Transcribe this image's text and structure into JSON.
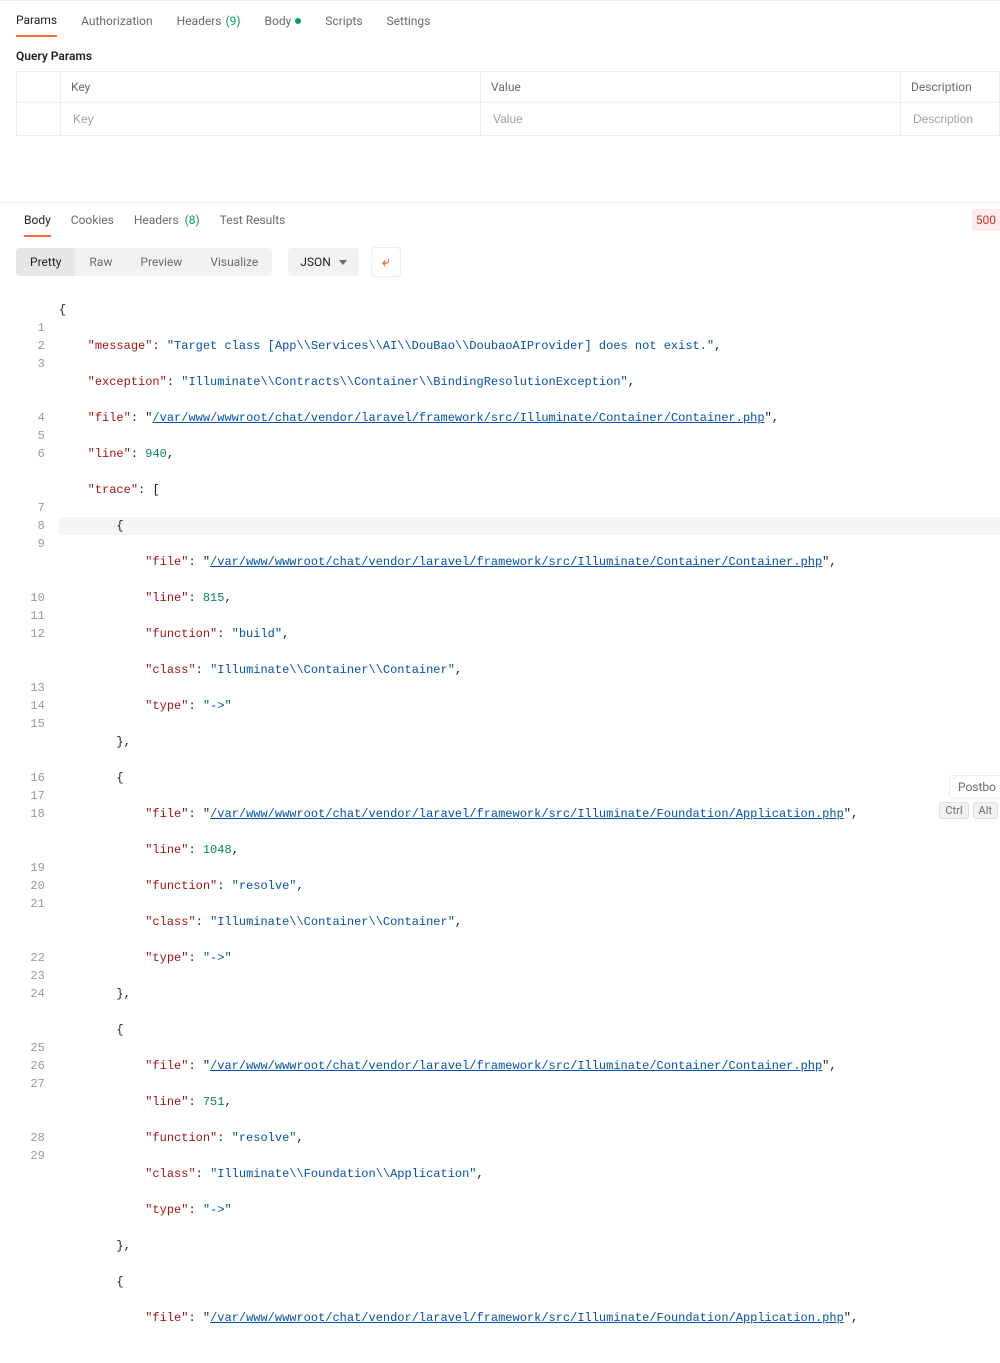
{
  "req_tabs": {
    "params": "Params",
    "authorization": "Authorization",
    "headers_label": "Headers",
    "headers_count": "(9)",
    "body": "Body",
    "scripts": "Scripts",
    "settings": "Settings"
  },
  "qp": {
    "title": "Query Params",
    "col_key": "Key",
    "col_value": "Value",
    "col_desc": "Description",
    "ph_key": "Key",
    "ph_value": "Value",
    "ph_desc": "Description"
  },
  "resp_tabs": {
    "body": "Body",
    "cookies": "Cookies",
    "headers_label": "Headers",
    "headers_count": "(8)",
    "test_results": "Test Results"
  },
  "status_code": "500",
  "toolbar": {
    "pretty": "Pretty",
    "raw": "Raw",
    "preview": "Preview",
    "visualize": "Visualize",
    "json": "JSON"
  },
  "code": {
    "l1": "{",
    "l2_k": "\"message\"",
    "l2_v": "\"Target class [App\\\\Services\\\\AI\\\\DouBao\\\\DoubaoAIProvider] does not exist.\"",
    "l3_k": "\"exception\"",
    "l3_v": "\"Illuminate\\\\Contracts\\\\Container\\\\BindingResolutionException\"",
    "l4_k": "\"file\"",
    "l4_v": "/var/www/wwwroot/chat/vendor/laravel/framework/src/Illuminate/Container/Container.php",
    "l5_k": "\"line\"",
    "l5_v": "940",
    "l6_k": "\"trace\"",
    "l7": "{",
    "l8_k": "\"file\"",
    "l8_v": "/var/www/wwwroot/chat/vendor/laravel/framework/src/Illuminate/Container/Container.php",
    "l9_k": "\"line\"",
    "l9_v": "815",
    "l10_k": "\"function\"",
    "l10_v": "\"build\"",
    "l11_k": "\"class\"",
    "l11_v": "\"Illuminate\\\\Container\\\\Container\"",
    "l12_k": "\"type\"",
    "l12_v": "\"->\"",
    "l13": "},",
    "l14": "{",
    "l15_k": "\"file\"",
    "l15_v": "/var/www/wwwroot/chat/vendor/laravel/framework/src/Illuminate/Foundation/Application.php",
    "l16_k": "\"line\"",
    "l16_v": "1048",
    "l17_k": "\"function\"",
    "l17_v": "\"resolve\"",
    "l18_k": "\"class\"",
    "l18_v": "\"Illuminate\\\\Container\\\\Container\"",
    "l19_k": "\"type\"",
    "l19_v": "\"->\"",
    "l20": "},",
    "l21": "{",
    "l22_k": "\"file\"",
    "l22_v": "/var/www/wwwroot/chat/vendor/laravel/framework/src/Illuminate/Container/Container.php",
    "l23_k": "\"line\"",
    "l23_v": "751",
    "l24_k": "\"function\"",
    "l24_v": "\"resolve\"",
    "l25_k": "\"class\"",
    "l25_v": "\"Illuminate\\\\Foundation\\\\Application\"",
    "l26_k": "\"type\"",
    "l26_v": "\"->\"",
    "l27": "},",
    "l28": "{",
    "l29_k": "\"file\"",
    "l29_v": "/var/www/wwwroot/chat/vendor/laravel/framework/src/Illuminate/Foundation/Application.php"
  },
  "line_numbers": [
    "1",
    "2",
    "3",
    "4",
    "5",
    "6",
    "7",
    "8",
    "9",
    "10",
    "11",
    "12",
    "13",
    "14",
    "15",
    "16",
    "17",
    "18",
    "19",
    "20",
    "21",
    "22",
    "23",
    "24",
    "25",
    "26",
    "27",
    "28",
    "29"
  ],
  "postbot": "Postbo",
  "key_ctrl": "Ctrl",
  "key_alt": "Alt"
}
